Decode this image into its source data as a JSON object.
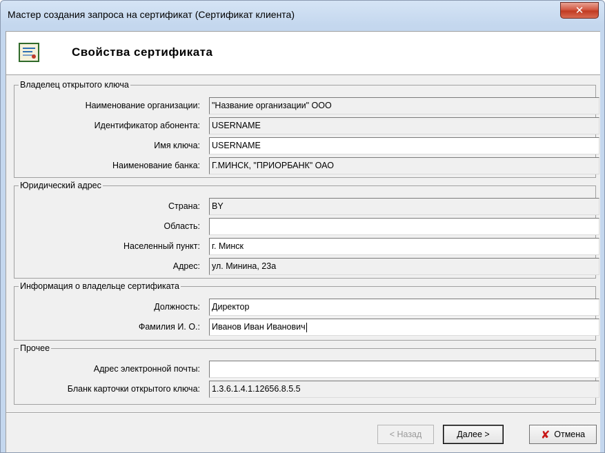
{
  "window": {
    "title": "Мастер создания запроса на сертификат (Сертификат клиента)",
    "close_glyph": "✕"
  },
  "header": {
    "title": "Свойства сертификата"
  },
  "groups": {
    "owner": {
      "legend": "Владелец открытого ключа",
      "org_name": {
        "label": "Наименование организации:",
        "value": "\"Название организации\" ООО"
      },
      "subscriber_id": {
        "label": "Идентификатор абонента:",
        "value": "USERNAME"
      },
      "key_name": {
        "label": "Имя ключа:",
        "value": "USERNAME"
      },
      "bank_name": {
        "label": "Наименование банка:",
        "value": "Г.МИНСК, \"ПРИОРБАНК\" ОАО"
      }
    },
    "address": {
      "legend": "Юридический адрес",
      "country": {
        "label": "Страна:",
        "value": "BY"
      },
      "region": {
        "label": "Область:",
        "value": ""
      },
      "locality": {
        "label": "Населенный пункт:",
        "value": "г. Минск"
      },
      "street": {
        "label": "Адрес:",
        "value": "ул. Минина, 23а"
      }
    },
    "holder": {
      "legend": "Информация о владельце сертификата",
      "position": {
        "label": "Должность:",
        "value": "Директор"
      },
      "full_name": {
        "label": "Фамилия И. О.:",
        "value": "Иванов Иван Иванович"
      }
    },
    "other": {
      "legend": "Прочее",
      "email": {
        "label": "Адрес электронной почты:",
        "value": ""
      },
      "key_card_form": {
        "label": "Бланк карточки открытого ключа:",
        "value": "1.3.6.1.4.1.12656.8.5.5"
      }
    }
  },
  "buttons": {
    "back": "< Назад",
    "next": "Далее >",
    "cancel": "Отмена",
    "cancel_icon_glyph": "✘"
  },
  "colors": {
    "titlebar": "#c4d7ee",
    "dialog_bg": "#f0f0f0",
    "close_red": "#c13b22",
    "cancel_icon": "#c81818"
  }
}
